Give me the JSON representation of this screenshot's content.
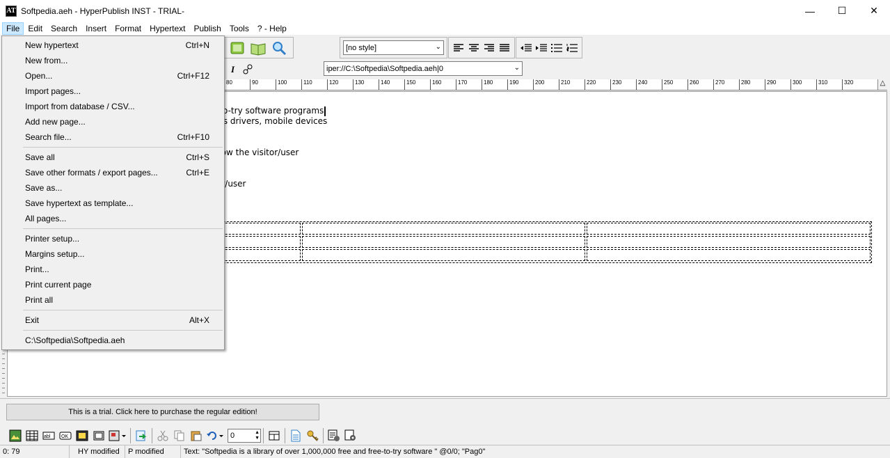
{
  "window": {
    "title": "Softpedia.aeh - HyperPublish INST - TRIAL-",
    "app_icon": "AT"
  },
  "menubar": [
    "File",
    "Edit",
    "Search",
    "Insert",
    "Format",
    "Hypertext",
    "Publish",
    "Tools",
    "? - Help"
  ],
  "toolbar": {
    "style_select": "[no style]",
    "url_select": "iper://C:\\Softpedia\\Softpedia.aeh|0"
  },
  "ruler": [
    "80",
    "90",
    "100",
    "110",
    "120",
    "130",
    "140",
    "150",
    "160",
    "170",
    "180",
    "190",
    "200",
    "210",
    "220",
    "230",
    "240",
    "250",
    "260",
    "270",
    "280",
    "290",
    "300",
    "310",
    "320"
  ],
  "editor": {
    "lines": [
      "-to-try software programs",
      "ws drivers, mobile devices",
      "llow the visitor/user",
      "or/user"
    ]
  },
  "file_menu": {
    "groups": [
      [
        {
          "label": "New hypertext",
          "shortcut": "Ctrl+N"
        },
        {
          "label": "New from...",
          "shortcut": ""
        },
        {
          "label": "Open...",
          "shortcut": "Ctrl+F12"
        },
        {
          "label": "Import pages...",
          "shortcut": ""
        },
        {
          "label": "Import from database / CSV...",
          "shortcut": ""
        },
        {
          "label": "Add new page...",
          "shortcut": ""
        },
        {
          "label": "Search file...",
          "shortcut": "Ctrl+F10"
        }
      ],
      [
        {
          "label": "Save all",
          "shortcut": "Ctrl+S"
        },
        {
          "label": "Save other formats / export pages...",
          "shortcut": "Ctrl+E"
        },
        {
          "label": "Save as...",
          "shortcut": ""
        },
        {
          "label": "Save hypertext as template...",
          "shortcut": ""
        },
        {
          "label": "All pages...",
          "shortcut": ""
        }
      ],
      [
        {
          "label": "Printer setup...",
          "shortcut": ""
        },
        {
          "label": "Margins setup...",
          "shortcut": ""
        },
        {
          "label": "Print...",
          "shortcut": ""
        },
        {
          "label": "Print current page",
          "shortcut": ""
        },
        {
          "label": "Print all",
          "shortcut": ""
        }
      ],
      [
        {
          "label": "Exit",
          "shortcut": "Alt+X"
        }
      ],
      [
        {
          "label": "C:\\Softpedia\\Softpedia.aeh",
          "shortcut": ""
        }
      ]
    ]
  },
  "trial_button": "This is a trial. Click here to purchase the regular edition!",
  "bottom_toolbar": {
    "spin_value": "0"
  },
  "statusbar": {
    "position": "0: 79",
    "hy_status": "HY modified",
    "p_status": "P modified",
    "text_info": "Text: \"Softpedia is a library of over 1,000,000 free and free-to-try software \" @0/0; \"Pag0\""
  }
}
